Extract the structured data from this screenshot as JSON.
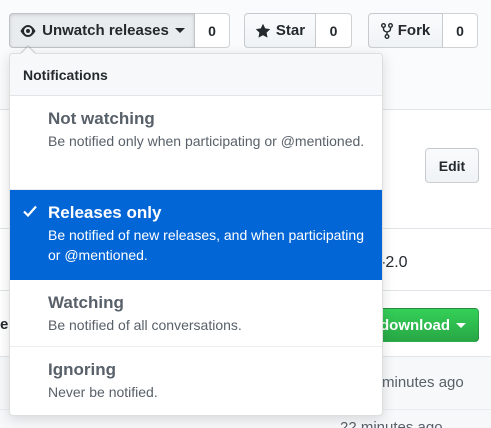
{
  "header": {
    "watch": {
      "label": "Unwatch releases",
      "count": "0",
      "icon": "eye-icon"
    },
    "star": {
      "label": "Star",
      "count": "0",
      "icon": "star-icon"
    },
    "fork": {
      "label": "Fork",
      "count": "0",
      "icon": "repo-forked-icon"
    }
  },
  "background": {
    "edit_label": "Edit",
    "license_fragment": "-2.0",
    "download_label": "download",
    "time_1": "minutes ago",
    "time_2": "22 minutes ago",
    "left_fragment": "e"
  },
  "dropdown": {
    "header": "Notifications",
    "items": [
      {
        "title": "Not watching",
        "desc": "Be notified only when participating or @mentioned.",
        "selected": false
      },
      {
        "title": "Releases only",
        "desc": "Be notified of new releases, and when participating or @mentioned.",
        "selected": true,
        "icon": "check-icon"
      },
      {
        "title": "Watching",
        "desc": "Be notified of all conversations.",
        "selected": false
      },
      {
        "title": "Ignoring",
        "desc": "Never be notified.",
        "selected": false
      }
    ]
  },
  "colors": {
    "selected_bg": "#0366d6",
    "download_green": "#28a745",
    "muted_text": "#586069"
  }
}
